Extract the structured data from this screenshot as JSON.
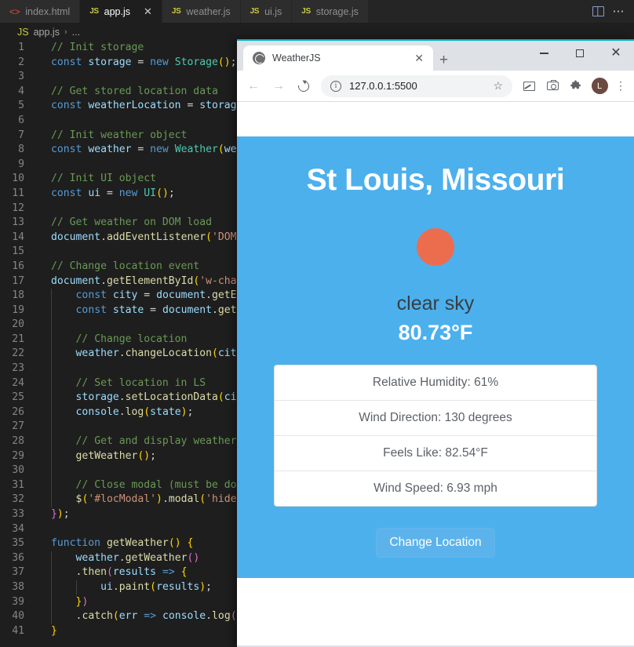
{
  "editor": {
    "tabs": [
      {
        "label": "index.html",
        "icon": "html-file-icon",
        "icon_text": "<>",
        "active": false,
        "closable": false
      },
      {
        "label": "app.js",
        "icon": "js-file-icon",
        "icon_text": "JS",
        "active": true,
        "closable": true,
        "close_glyph": "✕"
      },
      {
        "label": "weather.js",
        "icon": "js-file-icon",
        "icon_text": "JS",
        "active": false,
        "closable": false
      },
      {
        "label": "ui.js",
        "icon": "js-file-icon",
        "icon_text": "JS",
        "active": false,
        "closable": false
      },
      {
        "label": "storage.js",
        "icon": "js-file-icon",
        "icon_text": "JS",
        "active": false,
        "closable": false
      }
    ],
    "actions": {
      "split_editor": "split-editor-icon",
      "more_actions": "⋯"
    },
    "breadcrumb": {
      "icon_text": "JS",
      "file": "app.js",
      "separator": "›",
      "tail": "..."
    },
    "lines": [
      {
        "n": "1",
        "tokens": [
          {
            "t": "// Init storage",
            "c": "cm"
          }
        ]
      },
      {
        "n": "2",
        "tokens": [
          {
            "t": "const",
            "c": "kw"
          },
          {
            "t": " ",
            "c": "pl"
          },
          {
            "t": "storage",
            "c": "vr"
          },
          {
            "t": " = ",
            "c": "pl"
          },
          {
            "t": "new",
            "c": "kw"
          },
          {
            "t": " ",
            "c": "pl"
          },
          {
            "t": "Storage",
            "c": "cls"
          },
          {
            "t": "(",
            "c": "pn"
          },
          {
            "t": ")",
            "c": "pn"
          },
          {
            "t": ";",
            "c": "pl"
          }
        ]
      },
      {
        "n": "3",
        "tokens": []
      },
      {
        "n": "4",
        "tokens": [
          {
            "t": "// Get stored location data",
            "c": "cm"
          }
        ]
      },
      {
        "n": "5",
        "tokens": [
          {
            "t": "const",
            "c": "kw"
          },
          {
            "t": " ",
            "c": "pl"
          },
          {
            "t": "weatherLocation",
            "c": "vr"
          },
          {
            "t": " = ",
            "c": "pl"
          },
          {
            "t": "storag",
            "c": "vr"
          }
        ]
      },
      {
        "n": "6",
        "tokens": []
      },
      {
        "n": "7",
        "tokens": [
          {
            "t": "// Init weather object",
            "c": "cm"
          }
        ]
      },
      {
        "n": "8",
        "tokens": [
          {
            "t": "const",
            "c": "kw"
          },
          {
            "t": " ",
            "c": "pl"
          },
          {
            "t": "weather",
            "c": "vr"
          },
          {
            "t": " = ",
            "c": "pl"
          },
          {
            "t": "new",
            "c": "kw"
          },
          {
            "t": " ",
            "c": "pl"
          },
          {
            "t": "Weather",
            "c": "cls"
          },
          {
            "t": "(",
            "c": "pn"
          },
          {
            "t": "we",
            "c": "vr"
          }
        ]
      },
      {
        "n": "9",
        "tokens": []
      },
      {
        "n": "10",
        "tokens": [
          {
            "t": "// Init UI object",
            "c": "cm"
          }
        ]
      },
      {
        "n": "11",
        "tokens": [
          {
            "t": "const",
            "c": "kw"
          },
          {
            "t": " ",
            "c": "pl"
          },
          {
            "t": "ui",
            "c": "vr"
          },
          {
            "t": " = ",
            "c": "pl"
          },
          {
            "t": "new",
            "c": "kw"
          },
          {
            "t": " ",
            "c": "pl"
          },
          {
            "t": "UI",
            "c": "cls"
          },
          {
            "t": "(",
            "c": "pn"
          },
          {
            "t": ")",
            "c": "pn"
          },
          {
            "t": ";",
            "c": "pl"
          }
        ]
      },
      {
        "n": "12",
        "tokens": []
      },
      {
        "n": "13",
        "tokens": [
          {
            "t": "// Get weather on DOM load",
            "c": "cm"
          }
        ]
      },
      {
        "n": "14",
        "tokens": [
          {
            "t": "document",
            "c": "vr"
          },
          {
            "t": ".",
            "c": "pl"
          },
          {
            "t": "addEventListener",
            "c": "fn"
          },
          {
            "t": "(",
            "c": "pn"
          },
          {
            "t": "'DOM",
            "c": "st"
          }
        ]
      },
      {
        "n": "15",
        "tokens": []
      },
      {
        "n": "16",
        "tokens": [
          {
            "t": "// Change location event",
            "c": "cm"
          }
        ]
      },
      {
        "n": "17",
        "tokens": [
          {
            "t": "document",
            "c": "vr"
          },
          {
            "t": ".",
            "c": "pl"
          },
          {
            "t": "getElementById",
            "c": "fn"
          },
          {
            "t": "(",
            "c": "pn"
          },
          {
            "t": "'w-cha",
            "c": "st"
          }
        ]
      },
      {
        "n": "18",
        "indent": 1,
        "tokens": [
          {
            "t": "    ",
            "c": "pl"
          },
          {
            "t": "const",
            "c": "kw"
          },
          {
            "t": " ",
            "c": "pl"
          },
          {
            "t": "city",
            "c": "vr"
          },
          {
            "t": " = ",
            "c": "pl"
          },
          {
            "t": "document",
            "c": "vr"
          },
          {
            "t": ".",
            "c": "pl"
          },
          {
            "t": "getE",
            "c": "fn"
          }
        ]
      },
      {
        "n": "19",
        "indent": 1,
        "tokens": [
          {
            "t": "    ",
            "c": "pl"
          },
          {
            "t": "const",
            "c": "kw"
          },
          {
            "t": " ",
            "c": "pl"
          },
          {
            "t": "state",
            "c": "vr"
          },
          {
            "t": " = ",
            "c": "pl"
          },
          {
            "t": "document",
            "c": "vr"
          },
          {
            "t": ".",
            "c": "pl"
          },
          {
            "t": "get",
            "c": "fn"
          }
        ]
      },
      {
        "n": "20",
        "indent": 1,
        "tokens": []
      },
      {
        "n": "21",
        "indent": 1,
        "tokens": [
          {
            "t": "    ",
            "c": "pl"
          },
          {
            "t": "// Change location",
            "c": "cm"
          }
        ]
      },
      {
        "n": "22",
        "indent": 1,
        "tokens": [
          {
            "t": "    ",
            "c": "pl"
          },
          {
            "t": "weather",
            "c": "vr"
          },
          {
            "t": ".",
            "c": "pl"
          },
          {
            "t": "changeLocation",
            "c": "fn"
          },
          {
            "t": "(",
            "c": "pn"
          },
          {
            "t": "cit",
            "c": "vr"
          }
        ]
      },
      {
        "n": "23",
        "indent": 1,
        "tokens": []
      },
      {
        "n": "24",
        "indent": 1,
        "tokens": [
          {
            "t": "    ",
            "c": "pl"
          },
          {
            "t": "// Set location in LS",
            "c": "cm"
          }
        ]
      },
      {
        "n": "25",
        "indent": 1,
        "tokens": [
          {
            "t": "    ",
            "c": "pl"
          },
          {
            "t": "storage",
            "c": "vr"
          },
          {
            "t": ".",
            "c": "pl"
          },
          {
            "t": "setLocationData",
            "c": "fn"
          },
          {
            "t": "(",
            "c": "pn"
          },
          {
            "t": "ci",
            "c": "vr"
          }
        ]
      },
      {
        "n": "26",
        "indent": 1,
        "tokens": [
          {
            "t": "    ",
            "c": "pl"
          },
          {
            "t": "console",
            "c": "vr"
          },
          {
            "t": ".",
            "c": "pl"
          },
          {
            "t": "log",
            "c": "fn"
          },
          {
            "t": "(",
            "c": "pn"
          },
          {
            "t": "state",
            "c": "vr"
          },
          {
            "t": ")",
            "c": "pn"
          },
          {
            "t": ";",
            "c": "pl"
          }
        ]
      },
      {
        "n": "27",
        "indent": 1,
        "tokens": []
      },
      {
        "n": "28",
        "indent": 1,
        "tokens": [
          {
            "t": "    ",
            "c": "pl"
          },
          {
            "t": "// Get and display weather",
            "c": "cm"
          }
        ]
      },
      {
        "n": "29",
        "indent": 1,
        "tokens": [
          {
            "t": "    ",
            "c": "pl"
          },
          {
            "t": "getWeather",
            "c": "fn"
          },
          {
            "t": "(",
            "c": "pn"
          },
          {
            "t": ")",
            "c": "pn"
          },
          {
            "t": ";",
            "c": "pl"
          }
        ]
      },
      {
        "n": "30",
        "indent": 1,
        "tokens": []
      },
      {
        "n": "31",
        "indent": 1,
        "tokens": [
          {
            "t": "    ",
            "c": "pl"
          },
          {
            "t": "// Close modal (must be do",
            "c": "cm"
          }
        ]
      },
      {
        "n": "32",
        "indent": 1,
        "tokens": [
          {
            "t": "    ",
            "c": "pl"
          },
          {
            "t": "$",
            "c": "fn"
          },
          {
            "t": "(",
            "c": "pn"
          },
          {
            "t": "'#locModal'",
            "c": "st"
          },
          {
            "t": ")",
            "c": "pn"
          },
          {
            "t": ".",
            "c": "pl"
          },
          {
            "t": "modal",
            "c": "fn"
          },
          {
            "t": "(",
            "c": "pn"
          },
          {
            "t": "'hide",
            "c": "st"
          }
        ]
      },
      {
        "n": "33",
        "tokens": [
          {
            "t": "}",
            "c": "pn2"
          },
          {
            "t": ")",
            "c": "pn"
          },
          {
            "t": ";",
            "c": "pl"
          }
        ]
      },
      {
        "n": "34",
        "tokens": []
      },
      {
        "n": "35",
        "tokens": [
          {
            "t": "function",
            "c": "kw"
          },
          {
            "t": " ",
            "c": "pl"
          },
          {
            "t": "getWeather",
            "c": "fn"
          },
          {
            "t": "(",
            "c": "pn"
          },
          {
            "t": ")",
            "c": "pn"
          },
          {
            "t": " ",
            "c": "pl"
          },
          {
            "t": "{",
            "c": "pn"
          }
        ]
      },
      {
        "n": "36",
        "indent": 1,
        "tokens": [
          {
            "t": "    ",
            "c": "pl"
          },
          {
            "t": "weather",
            "c": "vr"
          },
          {
            "t": ".",
            "c": "pl"
          },
          {
            "t": "getWeather",
            "c": "fn"
          },
          {
            "t": "(",
            "c": "pn2"
          },
          {
            "t": ")",
            "c": "pn2"
          }
        ]
      },
      {
        "n": "37",
        "indent": 1,
        "tokens": [
          {
            "t": "    ",
            "c": "pl"
          },
          {
            "t": ".",
            "c": "pl"
          },
          {
            "t": "then",
            "c": "fn"
          },
          {
            "t": "(",
            "c": "pn2"
          },
          {
            "t": "results",
            "c": "vr"
          },
          {
            "t": " ",
            "c": "pl"
          },
          {
            "t": "=>",
            "c": "kw"
          },
          {
            "t": " ",
            "c": "pl"
          },
          {
            "t": "{",
            "c": "pn"
          }
        ]
      },
      {
        "n": "38",
        "indent": 2,
        "tokens": [
          {
            "t": "        ",
            "c": "pl"
          },
          {
            "t": "ui",
            "c": "vr"
          },
          {
            "t": ".",
            "c": "pl"
          },
          {
            "t": "paint",
            "c": "fn"
          },
          {
            "t": "(",
            "c": "pn"
          },
          {
            "t": "results",
            "c": "vr"
          },
          {
            "t": ")",
            "c": "pn"
          },
          {
            "t": ";",
            "c": "pl"
          }
        ]
      },
      {
        "n": "39",
        "indent": 1,
        "tokens": [
          {
            "t": "    ",
            "c": "pl"
          },
          {
            "t": "}",
            "c": "pn"
          },
          {
            "t": ")",
            "c": "pn2"
          }
        ]
      },
      {
        "n": "40",
        "indent": 1,
        "tokens": [
          {
            "t": "    ",
            "c": "pl"
          },
          {
            "t": ".",
            "c": "pl"
          },
          {
            "t": "catch",
            "c": "fn"
          },
          {
            "t": "(",
            "c": "pn"
          },
          {
            "t": "err",
            "c": "vr"
          },
          {
            "t": " ",
            "c": "pl"
          },
          {
            "t": "=>",
            "c": "kw"
          },
          {
            "t": " ",
            "c": "pl"
          },
          {
            "t": "console",
            "c": "vr"
          },
          {
            "t": ".",
            "c": "pl"
          },
          {
            "t": "log",
            "c": "fn"
          },
          {
            "t": "(",
            "c": "pn2"
          }
        ]
      },
      {
        "n": "41",
        "tokens": [
          {
            "t": "}",
            "c": "pn"
          }
        ]
      }
    ]
  },
  "browser": {
    "tab": {
      "title": "WeatherJS",
      "favicon": "globe-favicon",
      "close_glyph": "✕"
    },
    "new_tab_glyph": "+",
    "window_controls": {
      "minimize": "minimize-icon",
      "maximize": "maximize-icon",
      "close_glyph": "✕"
    },
    "nav": {
      "back_glyph": "←",
      "forward_glyph": "→",
      "reload": "reload-icon"
    },
    "omnibox": {
      "info_glyph": "i",
      "url": "127.0.0.1:5500",
      "bookmark_glyph": "☆"
    },
    "toolbar_icons": [
      {
        "name": "cast-icon"
      },
      {
        "name": "screenshot-camera-icon"
      },
      {
        "name": "extensions-puzzle-icon"
      }
    ],
    "profile": {
      "initial": "L",
      "color": "#6b4a42"
    },
    "menu_glyph": "⋮"
  },
  "weather_app": {
    "city": "St Louis, Missouri",
    "icon": "sun-clear-sky-icon",
    "icon_color": "#ec6c4e",
    "description": "clear sky",
    "temperature": "80.73°F",
    "details": [
      "Relative Humidity: 61%",
      "Wind Direction: 130 degrees",
      "Feels Like: 82.54°F",
      "Wind Speed: 6.93 mph"
    ],
    "change_location_label": "Change Location",
    "accent_color": "#4cb0ed"
  }
}
